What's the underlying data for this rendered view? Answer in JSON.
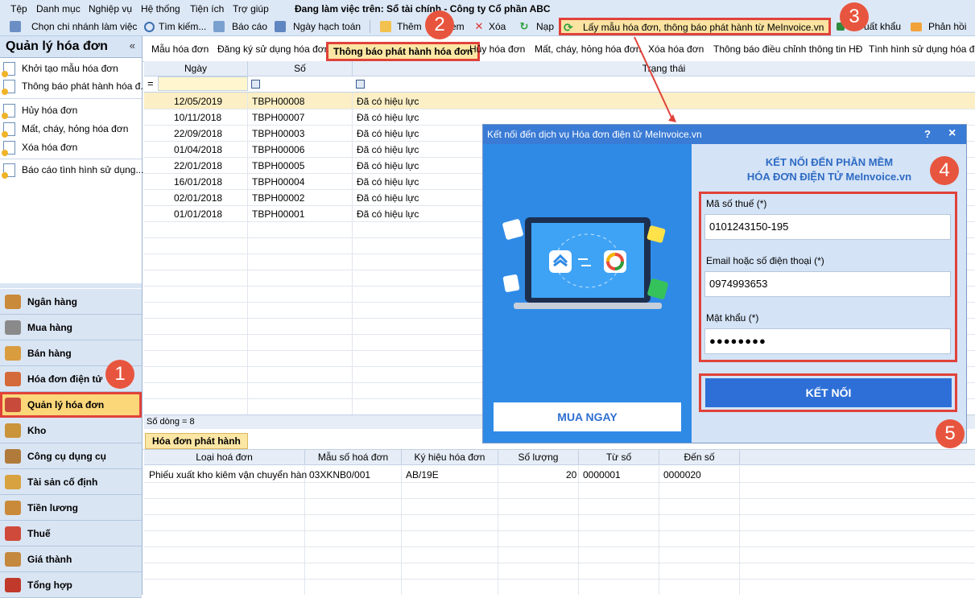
{
  "menu": {
    "items": [
      "Tệp",
      "Danh mục",
      "Nghiệp vụ",
      "Hệ thống",
      "Tiện ích",
      "Trợ giúp"
    ],
    "working_on": "Đang làm việc trên: Sổ tài chính - Công ty Cổ phần ABC"
  },
  "toolbar": {
    "chon_chi_nhanh": "Chọn chi nhánh làm việc",
    "tim_kiem": "Tìm kiếm...",
    "bao_cao": "Báo cáo",
    "ngay_hach_toan": "Ngày hạch toán",
    "them": "Thêm",
    "xem": "em",
    "xoa": "Xóa",
    "nap": "Nạp",
    "lay_mau": "Lấy mẫu hóa đơn, thông báo phát hành từ MeInvoice.vn",
    "xuat_khau": "uất khẩu",
    "phan_hoi": "Phản hồi"
  },
  "sidebar": {
    "title": "Quản lý hóa đơn",
    "collapse": "«",
    "links": [
      "Khởi tạo mẫu hóa đơn",
      "Thông báo phát hành hóa đ...",
      "Hủy hóa đơn",
      "Mất, cháy, hỏng hóa đơn",
      "Xóa hóa đơn",
      "Báo cáo tình hình sử dụng..."
    ],
    "modules": [
      "Ngân hàng",
      "Mua hàng",
      "Bán hàng",
      "Hóa đơn điện tử",
      "Quản lý hóa đơn",
      "Kho",
      "Công cụ dụng cụ",
      "Tài sản cố định",
      "Tiền lương",
      "Thuế",
      "Giá thành",
      "Tổng hợp"
    ]
  },
  "tabs": [
    "Mẫu hóa đơn",
    "Đăng ký sử dụng hóa đơn",
    "Thông báo phát hành hóa đơn",
    "Hủy hóa đơn",
    "Mất, cháy, hỏng hóa đơn",
    "Xóa hóa đơn",
    "Thông báo điều chỉnh thông tin HĐ",
    "Tình hình sử dụng hóa đơn"
  ],
  "grid": {
    "headers": {
      "ngay": "Ngày",
      "so": "Số",
      "trang_thai": "Trạng thái"
    },
    "filter_eq": "=",
    "rows": [
      {
        "ngay": "12/05/2019",
        "so": "TBPH00008",
        "trang_thai": "Đã có hiệu lực"
      },
      {
        "ngay": "10/11/2018",
        "so": "TBPH00007",
        "trang_thai": "Đã có hiệu lực"
      },
      {
        "ngay": "22/09/2018",
        "so": "TBPH00003",
        "trang_thai": "Đã có hiệu lực"
      },
      {
        "ngay": "01/04/2018",
        "so": "TBPH00006",
        "trang_thai": "Đã có hiệu lực"
      },
      {
        "ngay": "22/01/2018",
        "so": "TBPH00005",
        "trang_thai": "Đã có hiệu lực"
      },
      {
        "ngay": "16/01/2018",
        "so": "TBPH00004",
        "trang_thai": "Đã có hiệu lực"
      },
      {
        "ngay": "02/01/2018",
        "so": "TBPH00002",
        "trang_thai": "Đã có hiệu lực"
      },
      {
        "ngay": "01/01/2018",
        "so": "TBPH00001",
        "trang_thai": "Đã có hiệu lực"
      }
    ],
    "row_count": "Số dòng = 8"
  },
  "dialog": {
    "title": "Kết nối đến dịch vụ Hóa đơn điện tử MeInvoice.vn",
    "help": "?",
    "close": "×",
    "heading_line1": "KẾT NỐI ĐẾN PHẦN MỀM",
    "heading_line2": "HÓA ĐƠN ĐIỆN TỬ MeInvoice.vn",
    "mst_label": "Mã số thuế (*)",
    "mst_value": "0101243150-195",
    "email_label": "Email hoặc số điện thoại (*)",
    "email_value": "0974993653",
    "password_label": "Mật khẩu (*)",
    "password_value": "●●●●●●●●",
    "connect": "KẾT NỐI",
    "buy_now": "MUA NGAY"
  },
  "bottom": {
    "tab": "Hóa đơn phát hành",
    "headers": [
      "Loại hoá đơn",
      "Mẫu số hoá đơn",
      "Ký hiệu hóa đơn",
      "Số lượng",
      "Từ số",
      "Đến số"
    ],
    "row": {
      "loai": "Phiếu xuất kho kiêm vận chuyển hàn",
      "mau_so": "03XKNB0/001",
      "ky_hieu": "AB/19E",
      "so_luong": "20",
      "tu_so": "0000001",
      "den_so": "0000020"
    }
  },
  "badges": [
    "1",
    "2",
    "3",
    "4",
    "5"
  ],
  "colors": {
    "accent_red": "#e0423a",
    "badge": "#e8553e",
    "dialog_blue": "#2f8ae6",
    "button_blue": "#2d6fd6"
  }
}
